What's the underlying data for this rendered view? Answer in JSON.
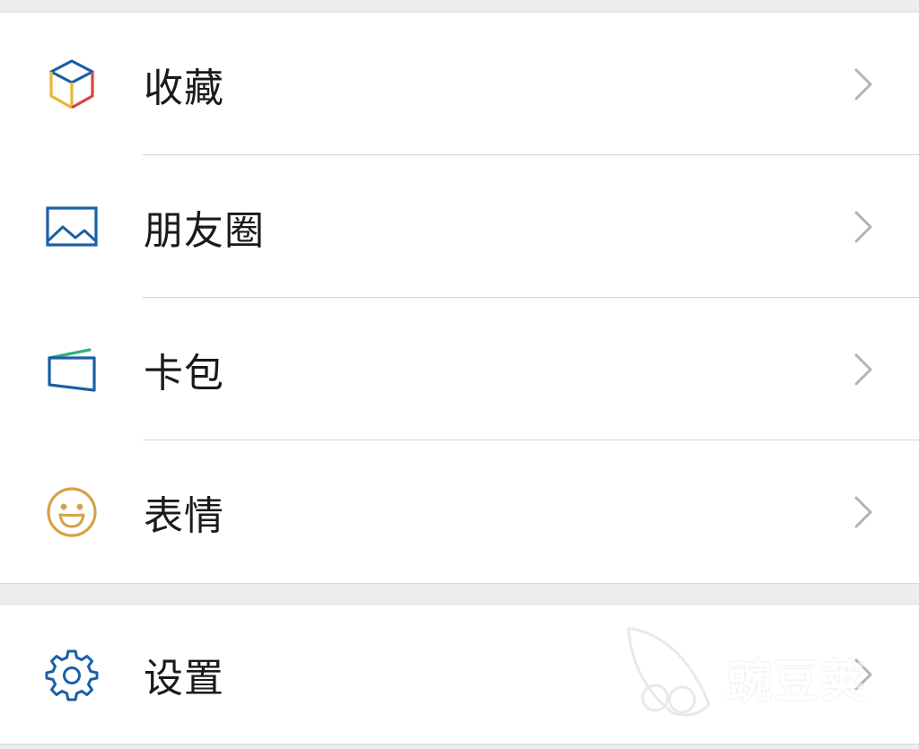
{
  "menu": {
    "items": [
      {
        "label": "收藏",
        "icon": "favorites-cube-icon"
      },
      {
        "label": "朋友圈",
        "icon": "moments-photo-icon"
      },
      {
        "label": "卡包",
        "icon": "card-wallet-icon"
      },
      {
        "label": "表情",
        "icon": "sticker-smiley-icon"
      }
    ],
    "settings": {
      "label": "设置",
      "icon": "gear-icon"
    }
  },
  "watermark": {
    "text": "豌豆荚"
  },
  "colors": {
    "background": "#ededed",
    "card": "#ffffff",
    "divider": "#d6d6d6",
    "text": "#1a1a1a",
    "chevron": "#b3b3b3",
    "blue": "#1a5fa8",
    "yellow": "#e8b830",
    "red": "#d64545",
    "green": "#2bb673",
    "smiley": "#d9a046"
  }
}
